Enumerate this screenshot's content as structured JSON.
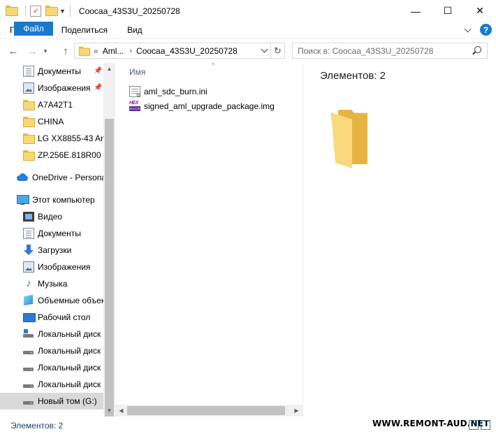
{
  "window": {
    "title": "Coocaa_43S3U_20250728",
    "minimize": "—",
    "maximize": "☐",
    "close": "✕"
  },
  "ribbon": {
    "tabs": [
      "Файл",
      "Главная",
      "Поделиться",
      "Вид"
    ],
    "help": "?"
  },
  "address": {
    "overflow": "«",
    "crumbs": [
      "Aml...",
      "Coocaa_43S3U_20250728"
    ],
    "separator": "›"
  },
  "search": {
    "placeholder": "Поиск в: Coocaa_43S3U_20250728"
  },
  "nav": {
    "items": [
      {
        "label": "Документы",
        "icon": "documents-icon",
        "pinned": true
      },
      {
        "label": "Изображения",
        "icon": "pictures-icon",
        "pinned": true
      },
      {
        "label": "A7A42T1",
        "icon": "folder-icon"
      },
      {
        "label": "CHINA",
        "icon": "folder-icon"
      },
      {
        "label": "LG XX8855-43 And",
        "icon": "folder-icon"
      },
      {
        "label": "ZP.256E.818R00",
        "icon": "folder-icon"
      },
      {
        "label": "OneDrive - Persona",
        "icon": "onedrive-icon",
        "root": true
      },
      {
        "label": "Этот компьютер",
        "icon": "computer-icon",
        "root": true
      },
      {
        "label": "Видео",
        "icon": "video-icon"
      },
      {
        "label": "Документы",
        "icon": "documents-icon"
      },
      {
        "label": "Загрузки",
        "icon": "downloads-icon"
      },
      {
        "label": "Изображения",
        "icon": "pictures-icon"
      },
      {
        "label": "Музыка",
        "icon": "music-icon"
      },
      {
        "label": "Объемные объек",
        "icon": "3d-objects-icon"
      },
      {
        "label": "Рабочий стол",
        "icon": "desktop-icon"
      },
      {
        "label": "Локальный диск",
        "icon": "system-drive-icon"
      },
      {
        "label": "Локальный диск",
        "icon": "drive-icon"
      },
      {
        "label": "Локальный диск",
        "icon": "drive-icon"
      },
      {
        "label": "Локальный диск",
        "icon": "drive-icon"
      },
      {
        "label": "Новый том (G:)",
        "icon": "drive-icon",
        "selected": true
      }
    ]
  },
  "content": {
    "column_name": "Имя",
    "sort_indicator": "^",
    "files": [
      {
        "name": "aml_sdc_burn.ini",
        "icon": "ini-file-icon"
      },
      {
        "name": "signed_aml_upgrade_package.img",
        "icon": "hex-file-icon",
        "icon_text_top": "HEX",
        "icon_text_bottom": "EDITOR"
      }
    ]
  },
  "details": {
    "count_text": "Элементов: 2"
  },
  "status": {
    "count_text": "Элементов: 2",
    "watermark": "WWW.REMONT-AUD.NET"
  },
  "colors": {
    "accent": "#1979ca",
    "folder": "#f8d775",
    "selection": "#d9d9d9"
  }
}
